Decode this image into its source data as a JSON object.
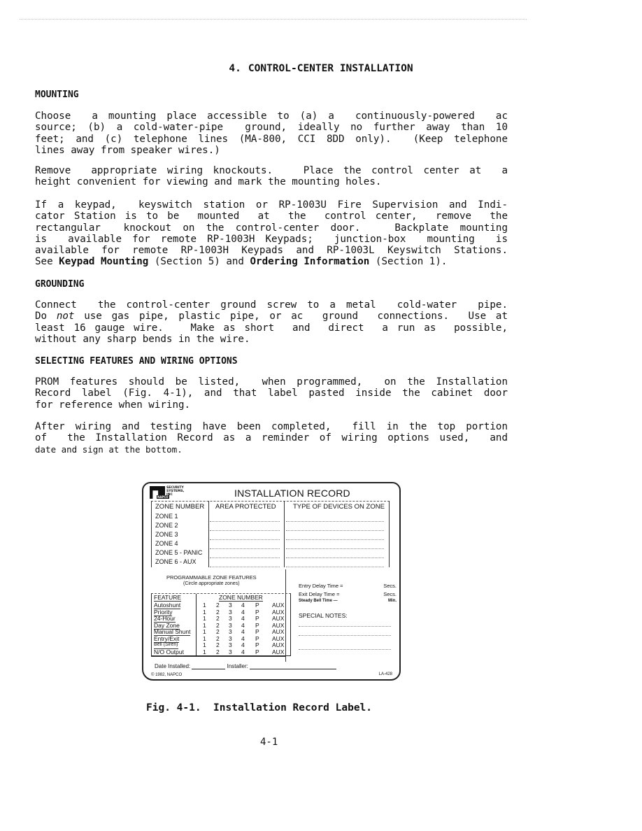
{
  "title": {
    "number": "4.",
    "text": "CONTROL-CENTER INSTALLATION"
  },
  "sections": {
    "mounting": {
      "heading": "MOUNTING",
      "para1": [
        "Choose  a mounting place accessible to (a) a  continuously-powered  ac",
        "source; (b) a cold-water-pipe  ground, ideally no further away than 10",
        "feet; and (c) telephone lines (MA-800, CCI 8DD only).  (Keep telephone",
        "lines away from speaker wires.)"
      ],
      "para2": [
        "Remove  appropriate wiring knockouts.   Place the control center at  a",
        "height convenient for viewing and mark the mounting holes."
      ],
      "para3": {
        "lines": [
          "If a keypad,  keyswitch station or RP-1003U Fire Supervision and Indi-",
          "cator Station is to be  mounted  at  the  control center,  remove  the",
          "rectangular  knockout on the control-center door.   Backplate mounting",
          "is  available for remote RP-1003H Keypads;  junction-box  mounting  is",
          "available for remote RP-1003H Keypads and RP-1003L Keyswitch Stations."
        ],
        "last_line": {
          "see": "See ",
          "ref1": "Keypad Mounting",
          "mid": " (Section 5) and ",
          "ref2": "Ordering Information",
          "end": " (Section 1)."
        }
      }
    },
    "grounding": {
      "heading": "GROUNDING",
      "line1": "Connect  the control-center ground screw to a metal  cold-water  pipe.",
      "line2_pre": "Do ",
      "line2_em": "not",
      "line2_post": " use gas pipe, plastic pipe, or ac  ground  connections.  Use at",
      "line3": "least 16 gauge wire.   Make as short  and  direct  a run as  possible,",
      "line4": "without any sharp bends in the wire."
    },
    "selecting": {
      "heading": "SELECTING FEATURES AND WIRING OPTIONS",
      "para1": [
        "PROM features should be listed,  when programmed,  on the Installation",
        "Record label (Fig. 4-1), and that label pasted inside the cabinet door",
        "for reference when wiring."
      ],
      "para2": [
        "After wiring and testing have been completed,  fill in the top portion",
        "of  the Installation Record as a reminder of wiring options used,  and",
        "date and sign at the bottom."
      ]
    }
  },
  "figure": {
    "logo": {
      "lines": [
        "NAPCO",
        "SECURITY",
        "SYSTEMS, INC"
      ],
      "brand": "NAPCO"
    },
    "title": "INSTALLATION RECORD",
    "zone_table": {
      "headers": [
        "ZONE NUMBER",
        "AREA PROTECTED",
        "TYPE OF DEVICES ON ZONE"
      ],
      "zones": [
        "ZONE 1",
        "ZONE 2",
        "ZONE 3",
        "ZONE 4",
        "ZONE 5 - PANIC",
        "ZONE 6 - AUX"
      ]
    },
    "programmable": {
      "title": "PROGRAMMABLE ZONE FEATURES",
      "subtitle": "(Circle appropriate zones)",
      "feature_header": "FEATURE",
      "zone_header": "ZONE NUMBER",
      "zone_columns": [
        "1",
        "2",
        "3",
        "4",
        "P",
        "AUX"
      ],
      "features": [
        "Autoshunt",
        "Priority",
        "24-Hour",
        "Day Zone",
        "Manual Shunt",
        "Entry/Exit",
        "Bell (Siren)",
        "N/O Output"
      ]
    },
    "settings": [
      {
        "label": "Entry Delay Time =",
        "unit": "Secs."
      },
      {
        "label": "Exit Delay Time =",
        "unit": "Secs."
      },
      {
        "label": "Steady Bell Time —",
        "unit": "Min."
      }
    ],
    "special_notes_label": "SPECIAL NOTES:",
    "date_installed_label": "Date Installed:",
    "installer_label": "Installer:",
    "copyright": "© 1982, NAPCO",
    "part_number": "LA-428"
  },
  "caption": {
    "fig": "Fig. 4-1.",
    "text": "Installation Record Label."
  },
  "page_number": "4-1"
}
